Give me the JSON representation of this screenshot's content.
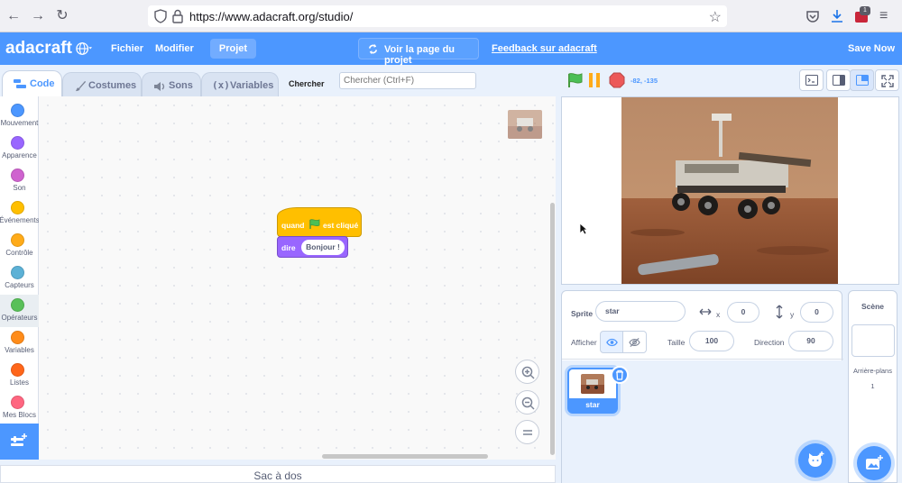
{
  "browser": {
    "url": "https://www.adacraft.org/studio/",
    "badge_count": "1"
  },
  "menubar": {
    "logo": "adacraft",
    "fichier": "Fichier",
    "modifier": "Modifier",
    "projet": "Projet",
    "voir": "Voir la page du projet",
    "feedback": "Feedback sur adacraft",
    "save_now": "Save Now"
  },
  "tabs": [
    {
      "label": "Code"
    },
    {
      "label": "Costumes"
    },
    {
      "label": "Sons"
    },
    {
      "label": "Variables"
    }
  ],
  "search": {
    "label": "Chercher",
    "placeholder": "Chercher (Ctrl+F)"
  },
  "categories": [
    {
      "label": "Mouvement",
      "color": "#4c97ff"
    },
    {
      "label": "Apparence",
      "color": "#9966ff"
    },
    {
      "label": "Son",
      "color": "#cf63cf"
    },
    {
      "label": "Événements",
      "color": "#ffbf00"
    },
    {
      "label": "Contrôle",
      "color": "#ffab19"
    },
    {
      "label": "Capteurs",
      "color": "#5cb1d6"
    },
    {
      "label": "Opérateurs",
      "color": "#59c059"
    },
    {
      "label": "Variables",
      "color": "#ff8c1a"
    },
    {
      "label": "Listes",
      "color": "#ff661a"
    },
    {
      "label": "Mes Blocs",
      "color": "#ff6680"
    }
  ],
  "blocks": {
    "hat_when": "quand",
    "hat_clicked": "est cliqué",
    "say": "dire",
    "say_value": "Bonjour !"
  },
  "backpack": "Sac à dos",
  "stage": {
    "coords": "-82, -135"
  },
  "sprite_info": {
    "sprite_label": "Sprite",
    "sprite_name": "star",
    "x_label": "x",
    "x_value": "0",
    "y_label": "y",
    "y_value": "0",
    "show_label": "Afficher",
    "size_label": "Taille",
    "size_value": "100",
    "direction_label": "Direction",
    "direction_value": "90"
  },
  "sprites": [
    {
      "name": "star"
    }
  ],
  "scene": {
    "title": "Scène",
    "backdrops_label": "Arrière-plans",
    "backdrops_count": "1"
  },
  "colors": {
    "accent": "#4c97ff",
    "events": "#ffbf00",
    "looks": "#9966ff"
  }
}
